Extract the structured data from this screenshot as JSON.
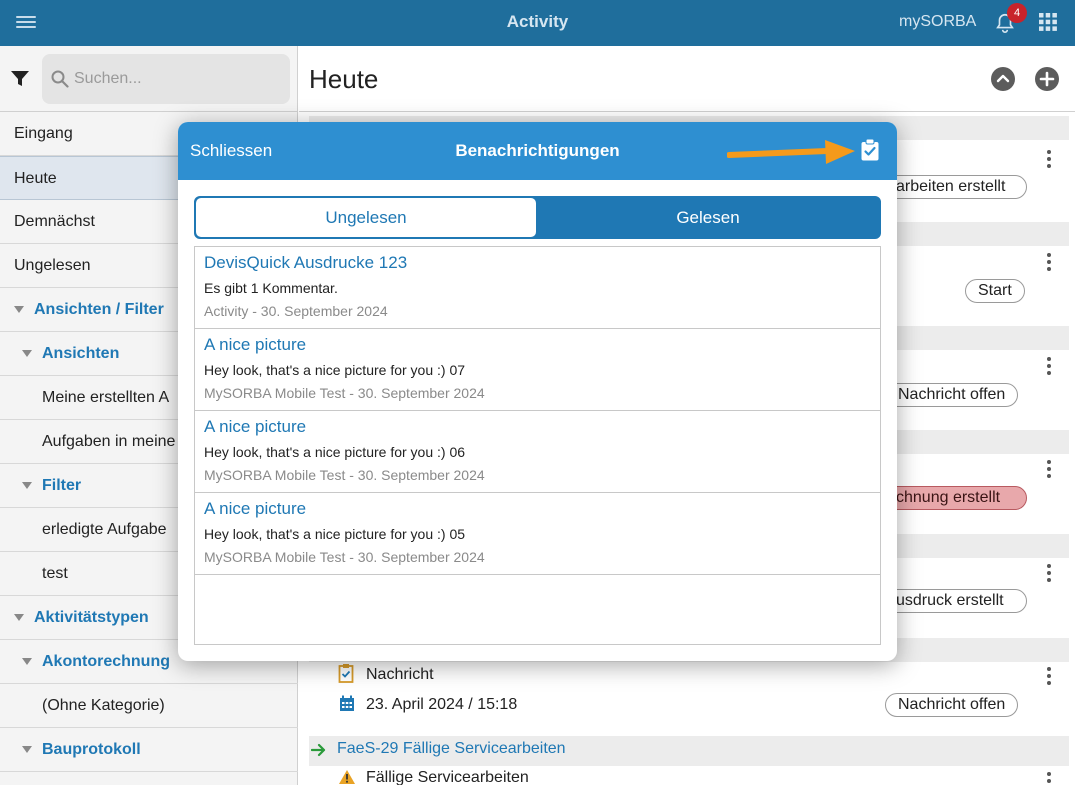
{
  "topbar": {
    "title": "Activity",
    "brand": "mySORBA",
    "notification_count": "4",
    "icons": {
      "menu": "hamburger-icon",
      "bell": "bell-icon",
      "apps": "grid-icon"
    },
    "color": "#1f6e9c"
  },
  "sidebar": {
    "search_placeholder": "Suchen...",
    "items": [
      {
        "label": "Eingang"
      },
      {
        "label": "Heute"
      },
      {
        "label": "Demnächst"
      },
      {
        "label": "Ungelesen"
      },
      {
        "label": "Ansichten / Filter"
      },
      {
        "label": "Ansichten"
      },
      {
        "label": "Meine erstellten A"
      },
      {
        "label": "Aufgaben in meine"
      },
      {
        "label": "Filter"
      },
      {
        "label": "erledigte Aufgabe"
      },
      {
        "label": "test"
      },
      {
        "label": "Aktivitätstypen"
      },
      {
        "label": "Akontorechnung"
      },
      {
        "label": "(Ohne Kategorie)"
      },
      {
        "label": "Bauprotokoll"
      }
    ]
  },
  "main": {
    "heading": "Heute",
    "pills": [
      "arbeiten erstellt",
      "Start",
      "Nachricht offen",
      "chnung erstellt",
      "usdruck erstellt",
      "Nachricht offen"
    ],
    "rows": {
      "nachricht": "Nachricht",
      "date": "23. April 2024 / 15:18",
      "link": "FaeS-29  Fällige Servicearbeiten",
      "faellig": "Fällige Servicearbeiten"
    }
  },
  "dialog": {
    "close_label": "Schliessen",
    "title": "Benachrichtigungen",
    "tabs": {
      "unread": "Ungelesen",
      "read": "Gelesen"
    },
    "notifications": [
      {
        "title": "DevisQuick Ausdrucke 123",
        "body": "Es gibt 1 Kommentar.",
        "meta": "Activity - 30. September 2024"
      },
      {
        "title": "A nice picture",
        "body": "Hey look, that's a nice picture for you :) 07",
        "meta": "MySORBA Mobile Test - 30. September 2024"
      },
      {
        "title": "A nice picture",
        "body": "Hey look, that's a nice picture for you :) 06",
        "meta": "MySORBA Mobile Test - 30. September 2024"
      },
      {
        "title": "A nice picture",
        "body": "Hey look, that's a nice picture for you :) 05",
        "meta": "MySORBA Mobile Test - 30. September 2024"
      }
    ],
    "accent": "#2e8fd1",
    "annotation_color": "#f59a1b"
  }
}
